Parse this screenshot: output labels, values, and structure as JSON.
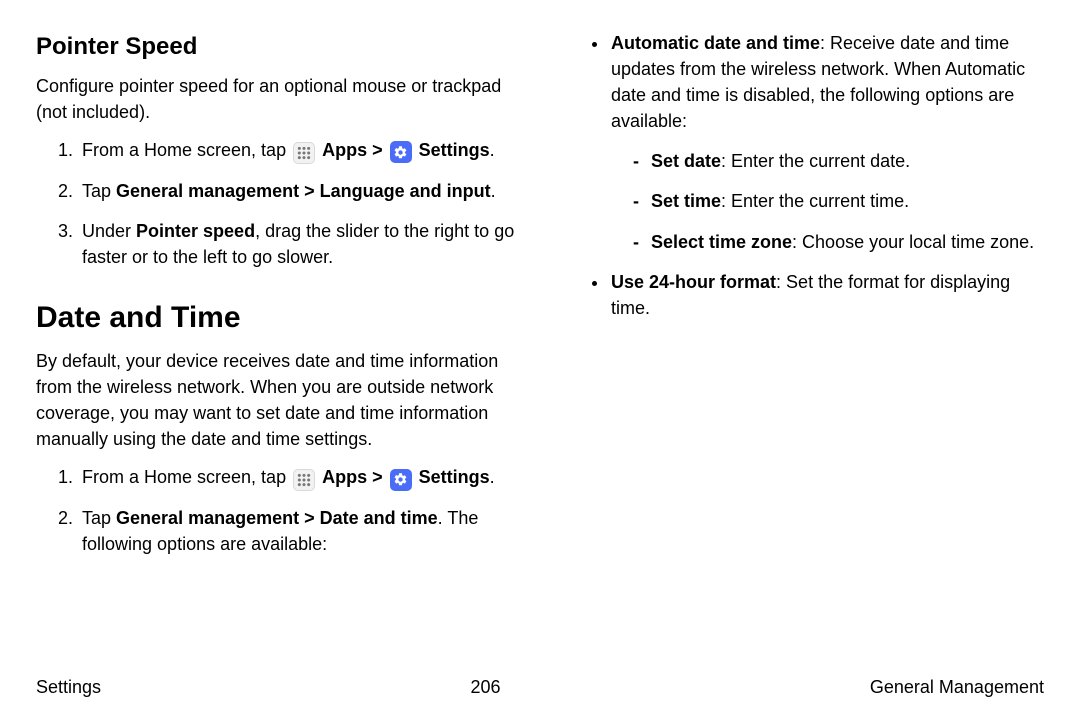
{
  "left": {
    "pointer_heading": "Pointer Speed",
    "pointer_desc": "Configure pointer speed for an optional mouse or trackpad (not included).",
    "step1_a": "From a Home screen, tap ",
    "apps_label": "Apps",
    "chev": " > ",
    "settings_label": "Settings",
    "period": ".",
    "step2_a": "Tap ",
    "step2_b": "General management",
    "step2_c": "Language and input",
    "step3_a": "Under ",
    "step3_b": "Pointer speed",
    "step3_c": ", drag the slider to the right to go faster or to the left to go slower.",
    "dt_heading": "Date and Time",
    "dt_desc": "By default, your device receives date and time information from the wireless network. When you are outside network coverage, you may want to set date and time information manually using the date and time settings.",
    "dt_step2_a": "Tap ",
    "dt_step2_b": "General management",
    "dt_step2_c": "Date and time",
    "dt_step2_d": ". The following options are available:"
  },
  "right": {
    "auto_bold": "Automatic date and time",
    "auto_rest": ": Receive date and time updates from the wireless network. When Automatic date and time is disabled, the following options are available:",
    "setdate_b": "Set date",
    "setdate_r": ": Enter the current date.",
    "settime_b": "Set time",
    "settime_r": ": Enter the current time.",
    "tz_b": "Select time zone",
    "tz_r": ": Choose your local time zone.",
    "h24_b": "Use 24-hour format",
    "h24_r": ": Set the format for displaying time."
  },
  "footer": {
    "left": "Settings",
    "center": "206",
    "right": "General Management"
  }
}
